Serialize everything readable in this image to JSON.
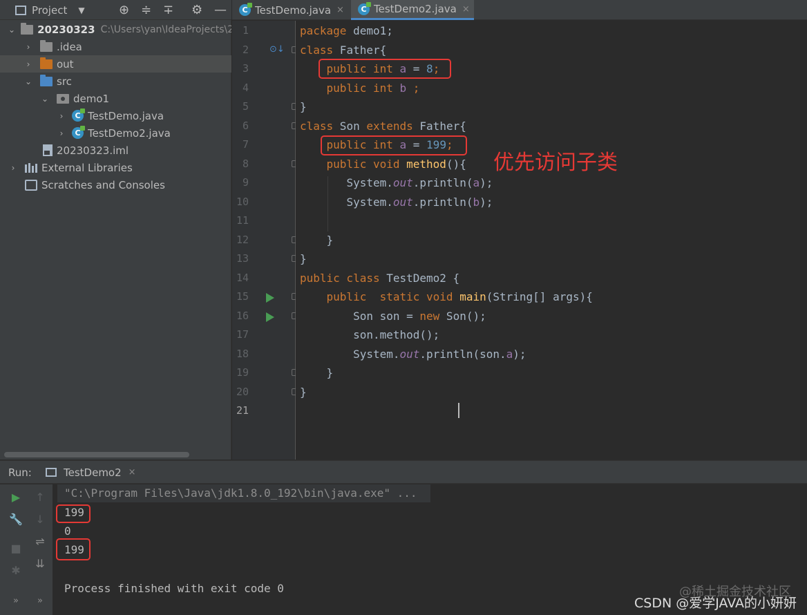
{
  "project_toolbar": {
    "title": "Project"
  },
  "tree": [
    {
      "label": "20230323",
      "path": "C:\\Users\\yan\\IdeaProjects\\20230323",
      "icon": "module-folder-icon"
    },
    {
      "label": ".idea",
      "icon": "folder-icon"
    },
    {
      "label": "out",
      "icon": "folder-orange-icon"
    },
    {
      "label": "src",
      "icon": "source-folder-icon"
    },
    {
      "label": "demo1",
      "icon": "package-icon"
    },
    {
      "label": "TestDemo.java",
      "icon": "java-class-icon"
    },
    {
      "label": "TestDemo2.java",
      "icon": "java-class-icon"
    },
    {
      "label": "20230323.iml",
      "icon": "iml-file-icon"
    },
    {
      "label": "External Libraries",
      "icon": "libraries-icon"
    },
    {
      "label": "Scratches and Consoles",
      "icon": "scratches-icon"
    }
  ],
  "tabs": [
    {
      "label": "TestDemo.java",
      "close": "×"
    },
    {
      "label": "TestDemo2.java",
      "close": "×"
    }
  ],
  "line_numbers": [
    "1",
    "2",
    "3",
    "4",
    "5",
    "6",
    "7",
    "8",
    "9",
    "10",
    "11",
    "12",
    "13",
    "14",
    "15",
    "16",
    "17",
    "18",
    "19",
    "20",
    "21"
  ],
  "code": {
    "l1_kw": "package",
    "l1_rest": " demo1;",
    "l2_kw": "class",
    "l2_rest": " Father{",
    "l3_kw": "public int",
    "l3_field": "a",
    "l3_eq": " = ",
    "l3_num": "8",
    "l3_end": ";",
    "l4_kw": "public int",
    "l4_field": "b",
    "l4_end": " ;",
    "l5": "}",
    "l6_kw": "class",
    "l6_name": " Son ",
    "l6_kw2": "extends",
    "l6_rest": " Father{",
    "l7_kw": "public int",
    "l7_field": "a",
    "l7_eq": " = ",
    "l7_num": "199",
    "l7_end": ";",
    "l8_kw": "public void",
    "l8_fn": "method",
    "l8_rest": "(){",
    "l9_a": "System.",
    "l9_b": "out",
    "l9_c": ".println(",
    "l9_d": "a",
    "l9_e": ");",
    "l10_a": "System.",
    "l10_b": "out",
    "l10_c": ".println(",
    "l10_d": "b",
    "l10_e": ");",
    "l12": "}",
    "l13": "}",
    "l14_kw": "public class",
    "l14_rest": " TestDemo2 {",
    "l15_kw": "public  static void",
    "l15_fn": "main",
    "l15_rest": "(String[] args){",
    "l16_a": "Son son = ",
    "l16_kw": "new",
    "l16_b": " Son();",
    "l17": "son.method();",
    "l18_a": "System.",
    "l18_b": "out",
    "l18_c": ".println(son.",
    "l18_d": "a",
    "l18_e": ");",
    "l19": "}",
    "l20": "}"
  },
  "annotation": "优先访问子类",
  "run": {
    "label": "Run:",
    "tab": "TestDemo2",
    "tab_close": "×",
    "command": "\"C:\\Program Files\\Java\\jdk1.8.0_192\\bin\\java.exe\" ...",
    "output": [
      "199",
      "0",
      "199"
    ],
    "finished": "Process finished with exit code 0",
    "more": "»"
  },
  "watermark": {
    "line1": "@稀土掘金技术社区",
    "line2": "CSDN @爱学JAVA的小妍妍"
  },
  "colors": {
    "keyword": "#cc7832",
    "function": "#ffc66d",
    "number": "#6897bb",
    "field": "#9876aa",
    "highlight": "#e53935",
    "run": "#499c54"
  }
}
